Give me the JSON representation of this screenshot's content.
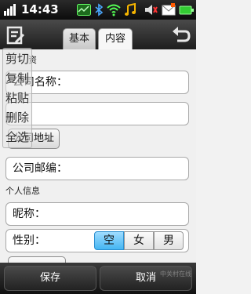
{
  "status_bar": {
    "time": "14:43",
    "icons": [
      "antenna-icon",
      "signal-icon",
      "bluetooth-icon",
      "wifi-icon",
      "music-icon",
      "mute-icon",
      "message-icon",
      "battery-icon"
    ]
  },
  "toolbar": {
    "tabs": [
      {
        "label": "基本"
      },
      {
        "label": "内容"
      }
    ]
  },
  "context_menu": {
    "items": [
      {
        "label": "剪切"
      },
      {
        "label": "复制"
      },
      {
        "label": "粘贴"
      },
      {
        "label": "删除"
      },
      {
        "label": "全选"
      }
    ]
  },
  "form": {
    "partial_section": "资",
    "company_name_label": "公司名称：",
    "address_partial": "地",
    "company_address_button": "公司地址",
    "company_email_label": "公司邮编：",
    "personal_section": "个人信息",
    "nickname_label": "昵称：",
    "gender_label": "性别：",
    "gender_options": [
      "空",
      "女",
      "男"
    ],
    "selected_gender": "空"
  },
  "bottom_bar": {
    "save": "保存",
    "cancel": "取消"
  },
  "watermark": "中关村在线"
}
